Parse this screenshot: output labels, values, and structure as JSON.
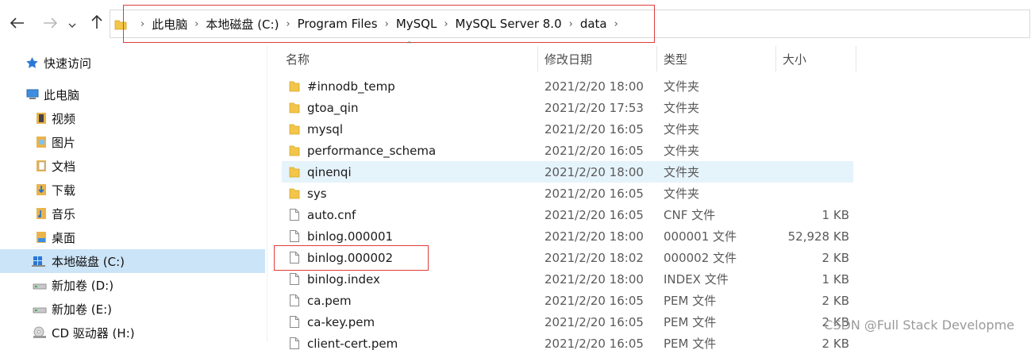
{
  "toolbar": {
    "back_icon": "arrow-left-icon",
    "forward_icon": "arrow-right-icon",
    "recent_icon": "chevron-down-icon",
    "up_icon": "arrow-up-icon"
  },
  "address_bar": {
    "crumbs": [
      "此电脑",
      "本地磁盘 (C:)",
      "Program Files",
      "MySQL",
      "MySQL Server 8.0",
      "data"
    ]
  },
  "sidebar": {
    "items": [
      {
        "label": "快速访问",
        "icon": "star-icon"
      },
      {
        "label": "此电脑",
        "icon": "computer-icon"
      },
      {
        "label": "视频",
        "icon": "video-folder-icon"
      },
      {
        "label": "图片",
        "icon": "pictures-folder-icon"
      },
      {
        "label": "文档",
        "icon": "documents-folder-icon"
      },
      {
        "label": "下载",
        "icon": "downloads-folder-icon"
      },
      {
        "label": "音乐",
        "icon": "music-folder-icon"
      },
      {
        "label": "桌面",
        "icon": "desktop-folder-icon"
      },
      {
        "label": "本地磁盘 (C:)",
        "icon": "windows-drive-icon"
      },
      {
        "label": "新加卷 (D:)",
        "icon": "drive-icon"
      },
      {
        "label": "新加卷 (E:)",
        "icon": "drive-icon"
      },
      {
        "label": "CD 驱动器 (H:)",
        "icon": "cd-drive-icon"
      }
    ]
  },
  "file_list": {
    "columns": {
      "name": "名称",
      "date": "修改日期",
      "type": "类型",
      "size": "大小"
    },
    "rows": [
      {
        "name": "#innodb_temp",
        "date": "2021/2/20 18:00",
        "type": "文件夹",
        "size": "",
        "kind": "folder"
      },
      {
        "name": "gtoa_qin",
        "date": "2021/2/20 17:53",
        "type": "文件夹",
        "size": "",
        "kind": "folder"
      },
      {
        "name": "mysql",
        "date": "2021/2/20 16:05",
        "type": "文件夹",
        "size": "",
        "kind": "folder"
      },
      {
        "name": "performance_schema",
        "date": "2021/2/20 16:05",
        "type": "文件夹",
        "size": "",
        "kind": "folder"
      },
      {
        "name": "qinenqi",
        "date": "2021/2/20 18:00",
        "type": "文件夹",
        "size": "",
        "kind": "folder"
      },
      {
        "name": "sys",
        "date": "2021/2/20 16:05",
        "type": "文件夹",
        "size": "",
        "kind": "folder"
      },
      {
        "name": "auto.cnf",
        "date": "2021/2/20 16:05",
        "type": "CNF 文件",
        "size": "1 KB",
        "kind": "file"
      },
      {
        "name": "binlog.000001",
        "date": "2021/2/20 18:00",
        "type": "000001 文件",
        "size": "52,928 KB",
        "kind": "file"
      },
      {
        "name": "binlog.000002",
        "date": "2021/2/20 18:02",
        "type": "000002 文件",
        "size": "2 KB",
        "kind": "file"
      },
      {
        "name": "binlog.index",
        "date": "2021/2/20 18:00",
        "type": "INDEX 文件",
        "size": "1 KB",
        "kind": "file"
      },
      {
        "name": "ca.pem",
        "date": "2021/2/20 16:05",
        "type": "PEM 文件",
        "size": "2 KB",
        "kind": "file"
      },
      {
        "name": "ca-key.pem",
        "date": "2021/2/20 16:05",
        "type": "PEM 文件",
        "size": "2 KB",
        "kind": "file"
      },
      {
        "name": "client-cert.pem",
        "date": "2021/2/20 16:05",
        "type": "PEM 文件",
        "size": "2 KB",
        "kind": "file"
      }
    ]
  },
  "watermark": "CSDN @Full Stack Developme",
  "colors": {
    "folder": "#f3c54a",
    "selection": "#cce4f7",
    "hover": "#e5f3fb",
    "annotation": "#e03c3c"
  }
}
